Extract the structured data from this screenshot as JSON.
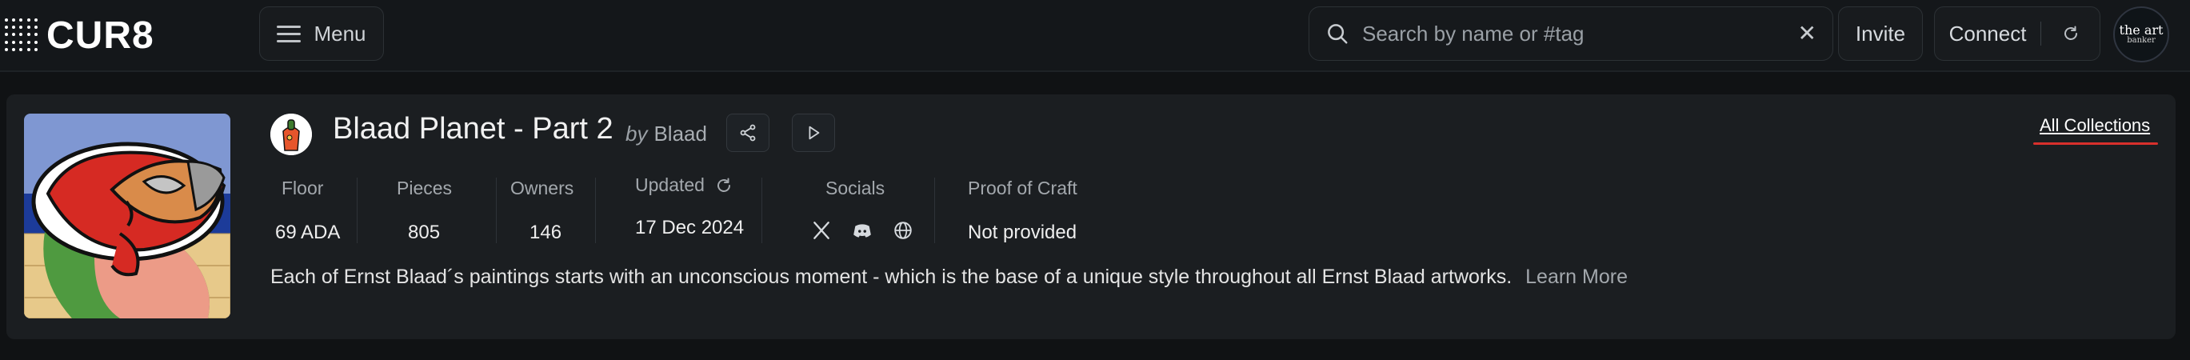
{
  "header": {
    "logo_text": "CUR8",
    "menu_label": "Menu",
    "search_placeholder": "Search by name or #tag",
    "search_value": "",
    "invite_label": "Invite",
    "connect_label": "Connect",
    "avatar_logo_text_1": "the art",
    "avatar_logo_text_2": "banker"
  },
  "collection": {
    "title": "Blaad Planet - Part 2",
    "by_label": "by",
    "creator": "Blaad",
    "all_collections_label": "All Collections",
    "stats": [
      {
        "label": "Floor",
        "value": "69 ADA"
      },
      {
        "label": "Pieces",
        "value": "805"
      },
      {
        "label": "Owners",
        "value": "146"
      },
      {
        "label": "Updated",
        "value": "17 Dec 2024"
      },
      {
        "label": "Socials",
        "value": ""
      },
      {
        "label": "Proof of Craft",
        "value": "Not provided"
      }
    ],
    "socials": [
      "x-icon",
      "discord-icon",
      "globe-icon"
    ],
    "description": "Each of Ernst Blaad´s paintings starts with an unconscious moment - which is the base of a unique style throughout all Ernst Blaad artworks.",
    "learn_more_label": "Learn More"
  },
  "colors": {
    "background": "#101214",
    "card": "#1b1e21",
    "accent_underline": "#d9302c",
    "text_primary": "#eeeeee",
    "text_muted": "#a3a8ad"
  }
}
